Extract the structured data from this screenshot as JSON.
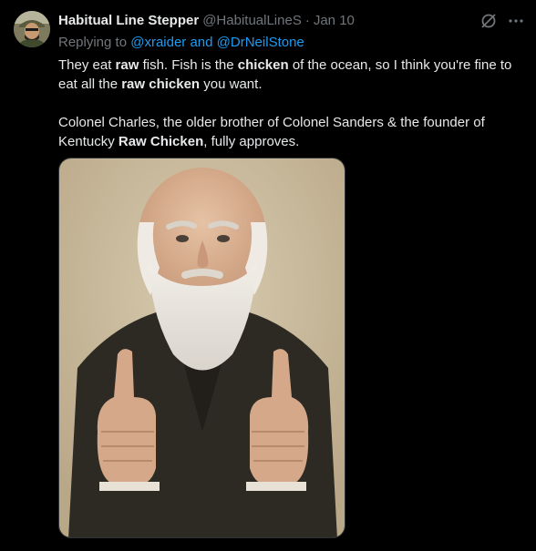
{
  "tweet": {
    "author": {
      "display_name": "Habitual Line Stepper",
      "handle": "@HabitualLineS",
      "avatar_icon": "avatar-photo-icon"
    },
    "separator": "·",
    "date": "Jan 10",
    "reply": {
      "prefix": "Replying to ",
      "mention1": "@xraider",
      "joiner": " and ",
      "mention2": "@DrNeilStone"
    },
    "paragraph1": {
      "t1": "They eat ",
      "b1": "raw",
      "t2": " fish. Fish is the ",
      "b2": "chicken",
      "t3": " of the ocean, so I think you're fine to eat all the ",
      "b3": "raw chicken",
      "t4": " you want."
    },
    "paragraph2": {
      "t1": "Colonel Charles, the older brother of Colonel Sanders & the founder of Kentucky ",
      "b1": "Raw Chicken",
      "t2": ", fully approves."
    },
    "media": {
      "description_icon": "bearded-man-thumbs-up-image"
    },
    "icons": {
      "grok": "grok-icon",
      "more": "more-options-icon"
    },
    "colors": {
      "background": "#000000",
      "text": "#e7e9ea",
      "muted": "#71767b",
      "link": "#1d9bf0"
    }
  }
}
